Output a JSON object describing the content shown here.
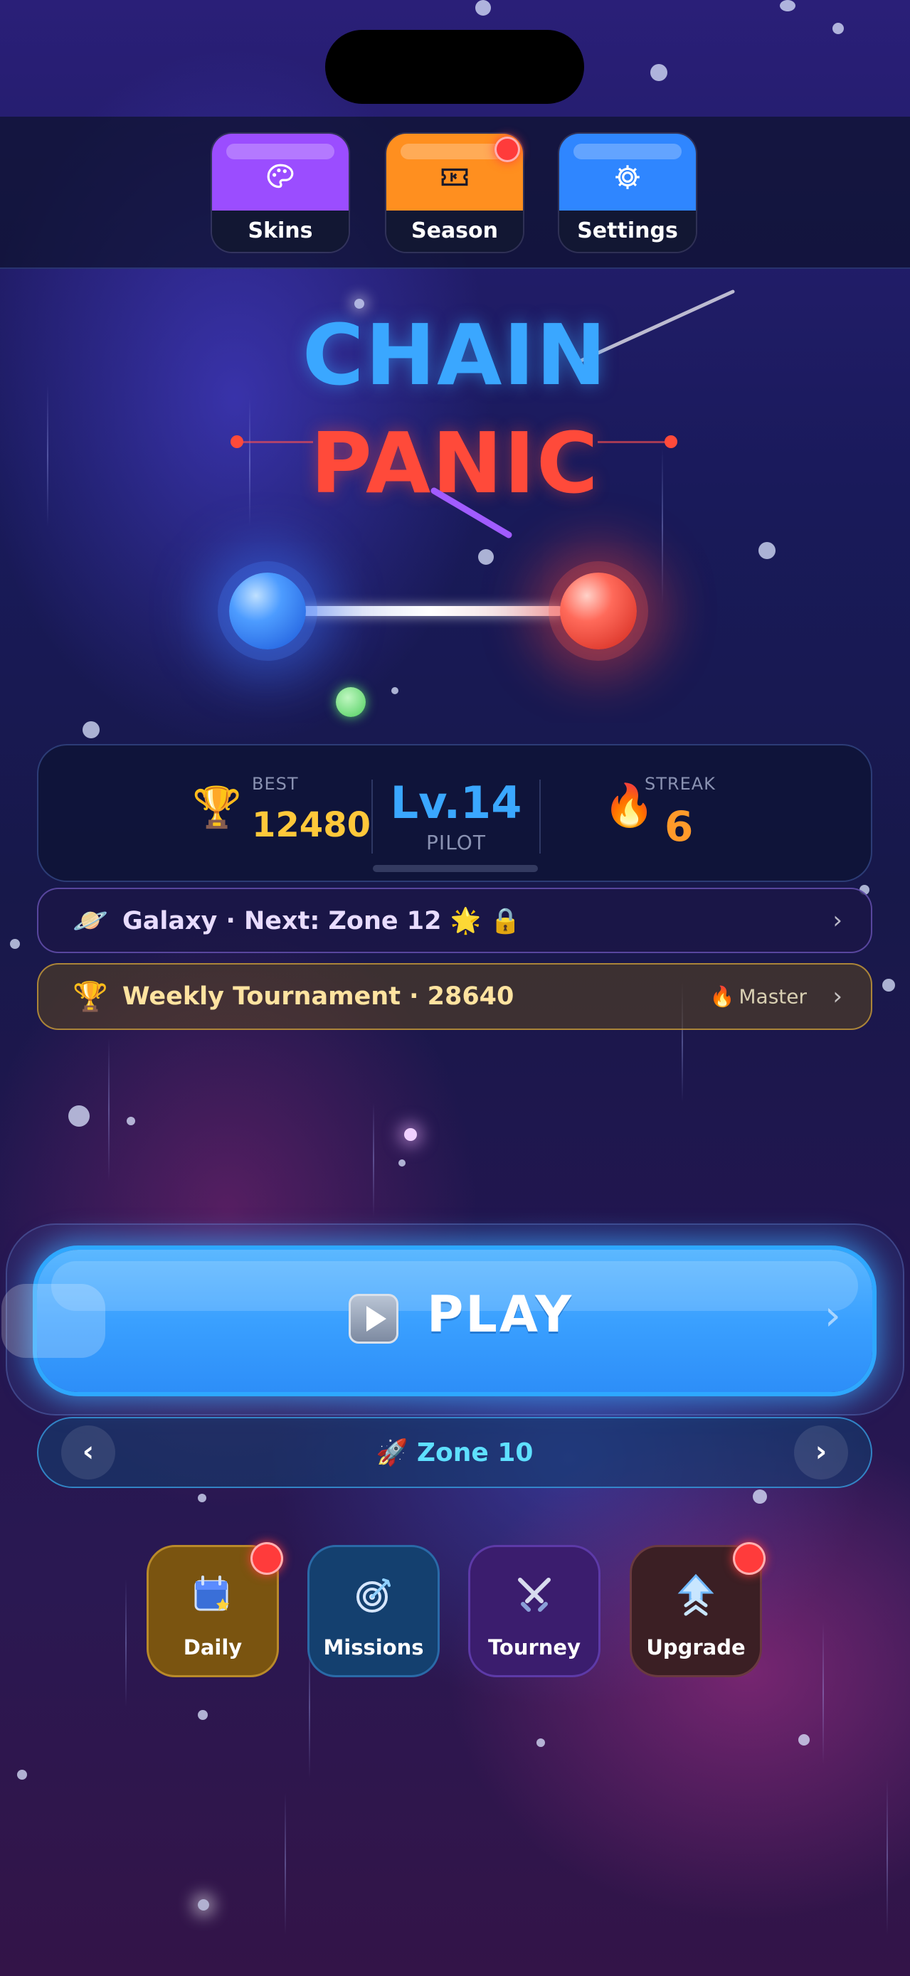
{
  "top_buttons": {
    "skins": {
      "label": "Skins",
      "color": "#9b4dff"
    },
    "season": {
      "label": "Season",
      "color": "#ff8f1f"
    },
    "settings": {
      "label": "Settings",
      "color": "#2f86ff"
    }
  },
  "title": {
    "line1": "CHAIN",
    "line2": "PANIC"
  },
  "stats": {
    "best_label": "BEST",
    "best_value": "12480",
    "level": "Lv.14",
    "rank": "PILOT",
    "streak_label": "STREAK",
    "streak_value": "6"
  },
  "galaxy_bar": {
    "text": "Galaxy · Next: Zone 12 🌟 🔒",
    "icon": "🪐"
  },
  "weekly_bar": {
    "text": "Weekly Tournament · 28640",
    "icon": "🏆",
    "tier_icon": "🔥",
    "tier": "Master"
  },
  "play_button": {
    "label": "PLAY"
  },
  "zone_selector": {
    "label": "🚀 Zone 10"
  },
  "bottom_buttons": {
    "daily": {
      "label": "Daily",
      "color": "#7a5410"
    },
    "missions": {
      "label": "Missions",
      "color": "#14406f"
    },
    "tourney": {
      "label": "Tourney",
      "color": "#3b1d6e"
    },
    "upgrade": {
      "label": "Upgrade",
      "color": "#3b1f24"
    }
  },
  "colors": {
    "accent_blue": "#3aa7ff",
    "accent_red": "#ff4a3a",
    "gold": "#ffc83a",
    "orange": "#ff9a2a",
    "notification": "#ff3b3b"
  }
}
